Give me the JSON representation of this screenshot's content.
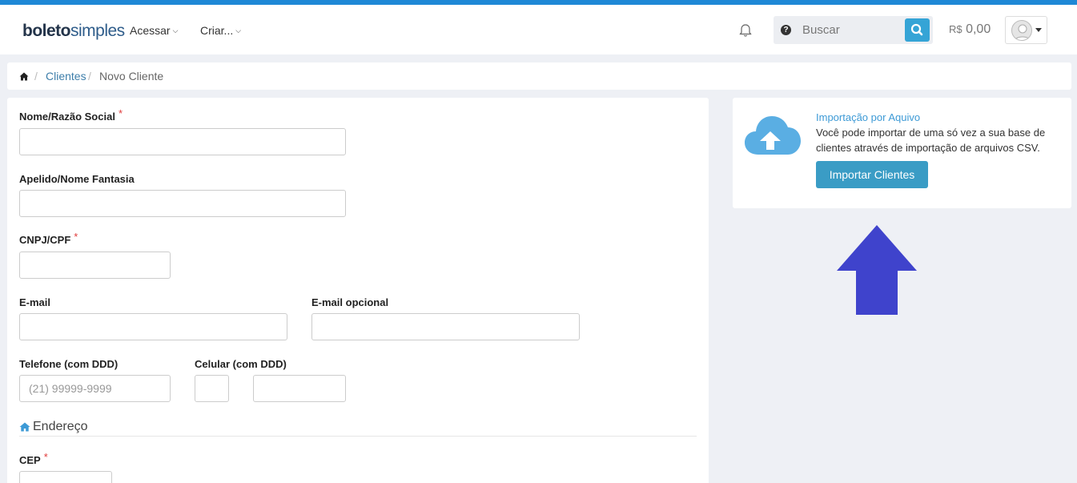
{
  "header": {
    "logo_bold": "boleto",
    "logo_light": "simples",
    "nav": [
      {
        "label": "Acessar"
      },
      {
        "label": "Criar..."
      }
    ],
    "search_placeholder": "Buscar",
    "balance_currency": "R$",
    "balance_value": "0,00"
  },
  "breadcrumb": {
    "items": [
      "Clientes",
      "Novo Cliente"
    ]
  },
  "form": {
    "nome_label": "Nome/Razão Social",
    "apelido_label": "Apelido/Nome Fantasia",
    "cnpj_label": "CNPJ/CPF",
    "email_label": "E-mail",
    "email_opcional_label": "E-mail opcional",
    "telefone_label": "Telefone (com DDD)",
    "telefone_placeholder": "(21) 99999-9999",
    "celular_label": "Celular (com DDD)",
    "section_endereco": "Endereço",
    "cep_label": "CEP",
    "required_marker": "*"
  },
  "import_panel": {
    "title": "Importação por Aquivo",
    "description": "Você pode importar de uma só vez a sua base de clientes através de importação de arquivos CSV.",
    "button_label": "Importar Clientes"
  },
  "colors": {
    "brand_blue": "#1e88d6",
    "button_blue": "#3a9cc5",
    "annotation_arrow": "#3f43cc",
    "required_red": "#e03b3b"
  }
}
